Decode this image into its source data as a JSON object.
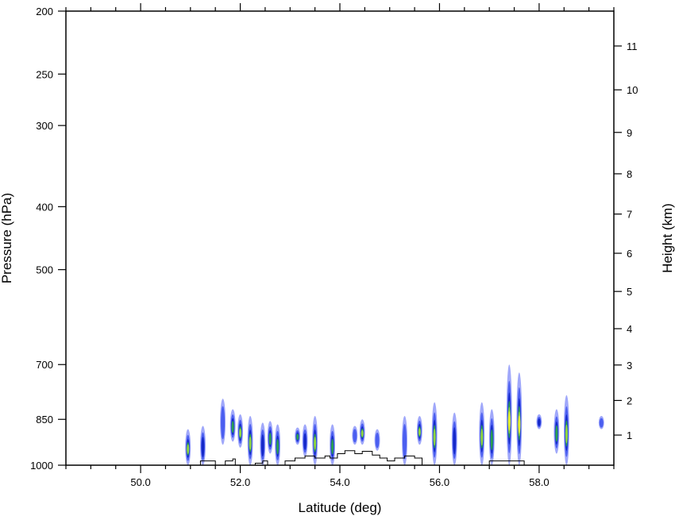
{
  "chart_data": {
    "type": "heatmap",
    "title": "",
    "xlabel": "Latitude (deg)",
    "ylabel": "Pressure (hPa)",
    "y2label": "Height (km)",
    "xlim": [
      48.5,
      59.5
    ],
    "ylim": [
      1000,
      200
    ],
    "y_scale": "log",
    "x_ticks": [
      {
        "value": 50.0,
        "label": "50.0"
      },
      {
        "value": 52.0,
        "label": "52.0"
      },
      {
        "value": 54.0,
        "label": "54.0"
      },
      {
        "value": 56.0,
        "label": "56.0"
      },
      {
        "value": 58.0,
        "label": "58.0"
      }
    ],
    "y_ticks": [
      {
        "value": 200,
        "label": "200"
      },
      {
        "value": 250,
        "label": "250"
      },
      {
        "value": 300,
        "label": "300"
      },
      {
        "value": 400,
        "label": "400"
      },
      {
        "value": 500,
        "label": "500"
      },
      {
        "value": 700,
        "label": "700"
      },
      {
        "value": 850,
        "label": "850"
      },
      {
        "value": 1000,
        "label": "1000"
      }
    ],
    "y2_ticks": [
      {
        "value": 1,
        "label": "1"
      },
      {
        "value": 2,
        "label": "2"
      },
      {
        "value": 3,
        "label": "3"
      },
      {
        "value": 4,
        "label": "4"
      },
      {
        "value": 5,
        "label": "5"
      },
      {
        "value": 6,
        "label": "6"
      },
      {
        "value": 7,
        "label": "7"
      },
      {
        "value": 8,
        "label": "8"
      },
      {
        "value": 9,
        "label": "9"
      },
      {
        "value": 10,
        "label": "10"
      },
      {
        "value": 11,
        "label": "11"
      }
    ],
    "level_colors": [
      "#a0a8fa",
      "#4a5ef0",
      "#1428c8",
      "#2aa050",
      "#8fd640",
      "#e4ee30"
    ],
    "cells": [
      {
        "lat": 50.95,
        "top": 880,
        "bottom": 1000,
        "peak": 4
      },
      {
        "lat": 51.25,
        "top": 870,
        "bottom": 1000,
        "peak": 2
      },
      {
        "lat": 51.65,
        "top": 790,
        "bottom": 930,
        "peak": 1
      },
      {
        "lat": 51.85,
        "top": 820,
        "bottom": 920,
        "peak": 3
      },
      {
        "lat": 52.0,
        "top": 835,
        "bottom": 940,
        "peak": 4
      },
      {
        "lat": 52.2,
        "top": 840,
        "bottom": 1000,
        "peak": 4
      },
      {
        "lat": 52.45,
        "top": 860,
        "bottom": 1000,
        "peak": 2
      },
      {
        "lat": 52.6,
        "top": 855,
        "bottom": 960,
        "peak": 3
      },
      {
        "lat": 52.75,
        "top": 865,
        "bottom": 1000,
        "peak": 3
      },
      {
        "lat": 53.15,
        "top": 875,
        "bottom": 930,
        "peak": 3
      },
      {
        "lat": 53.3,
        "top": 865,
        "bottom": 970,
        "peak": 2
      },
      {
        "lat": 53.5,
        "top": 840,
        "bottom": 1000,
        "peak": 4
      },
      {
        "lat": 53.85,
        "top": 865,
        "bottom": 1000,
        "peak": 3
      },
      {
        "lat": 54.3,
        "top": 870,
        "bottom": 930,
        "peak": 1
      },
      {
        "lat": 54.45,
        "top": 850,
        "bottom": 930,
        "peak": 4
      },
      {
        "lat": 54.75,
        "top": 880,
        "bottom": 950,
        "peak": 1
      },
      {
        "lat": 55.3,
        "top": 840,
        "bottom": 1000,
        "peak": 1
      },
      {
        "lat": 55.6,
        "top": 840,
        "bottom": 930,
        "peak": 4
      },
      {
        "lat": 55.9,
        "top": 800,
        "bottom": 1000,
        "peak": 4
      },
      {
        "lat": 56.3,
        "top": 830,
        "bottom": 1000,
        "peak": 2
      },
      {
        "lat": 56.85,
        "top": 800,
        "bottom": 1000,
        "peak": 4
      },
      {
        "lat": 57.05,
        "top": 820,
        "bottom": 1000,
        "peak": 3
      },
      {
        "lat": 57.4,
        "top": 700,
        "bottom": 1000,
        "peak": 5
      },
      {
        "lat": 57.6,
        "top": 720,
        "bottom": 1000,
        "peak": 5
      },
      {
        "lat": 58.0,
        "top": 835,
        "bottom": 880,
        "peak": 2
      },
      {
        "lat": 58.35,
        "top": 820,
        "bottom": 960,
        "peak": 3
      },
      {
        "lat": 58.55,
        "top": 780,
        "bottom": 1000,
        "peak": 4
      },
      {
        "lat": 59.25,
        "top": 840,
        "bottom": 880,
        "peak": 1
      }
    ],
    "terrain": [
      [
        51.2,
        1000
      ],
      [
        51.2,
        985
      ],
      [
        51.5,
        985
      ],
      [
        51.5,
        1000
      ],
      [
        51.7,
        1000
      ],
      [
        51.7,
        985
      ],
      [
        51.85,
        985
      ],
      [
        51.85,
        978
      ],
      [
        51.9,
        978
      ],
      [
        51.9,
        1000
      ],
      [
        52.3,
        1000
      ],
      [
        52.3,
        993
      ],
      [
        52.45,
        993
      ],
      [
        52.45,
        985
      ],
      [
        52.55,
        985
      ],
      [
        52.55,
        1000
      ],
      [
        52.9,
        1000
      ],
      [
        52.9,
        985
      ],
      [
        53.1,
        985
      ],
      [
        53.1,
        975
      ],
      [
        53.3,
        975
      ],
      [
        53.3,
        968
      ],
      [
        53.5,
        968
      ],
      [
        53.5,
        975
      ],
      [
        53.7,
        975
      ],
      [
        53.7,
        968
      ],
      [
        53.8,
        968
      ],
      [
        53.8,
        975
      ],
      [
        53.95,
        975
      ],
      [
        53.95,
        960
      ],
      [
        54.1,
        960
      ],
      [
        54.1,
        950
      ],
      [
        54.3,
        950
      ],
      [
        54.3,
        960
      ],
      [
        54.45,
        960
      ],
      [
        54.45,
        952
      ],
      [
        54.65,
        952
      ],
      [
        54.65,
        965
      ],
      [
        54.8,
        965
      ],
      [
        54.8,
        975
      ],
      [
        54.95,
        975
      ],
      [
        54.95,
        985
      ],
      [
        55.1,
        985
      ],
      [
        55.1,
        975
      ],
      [
        55.3,
        975
      ],
      [
        55.3,
        968
      ],
      [
        55.5,
        968
      ],
      [
        55.5,
        975
      ],
      [
        55.65,
        975
      ],
      [
        55.65,
        1000
      ],
      [
        57.0,
        1000
      ],
      [
        57.0,
        985
      ],
      [
        57.7,
        985
      ],
      [
        57.7,
        1000
      ]
    ]
  }
}
